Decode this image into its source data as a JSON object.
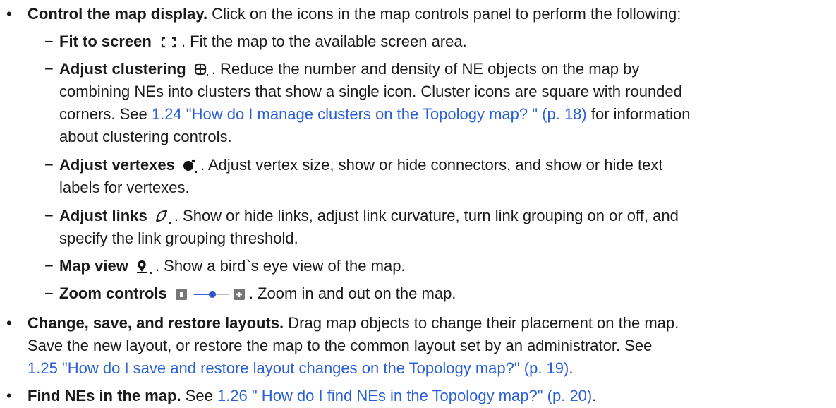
{
  "bullets": [
    {
      "title": "Control the map display.",
      "text": " Click on the icons in the map controls panel to perform the following:",
      "subitems": [
        {
          "title": "Fit to screen",
          "icon": "fit-screen-icon",
          "lines": [
            ". Fit the map to the available screen area."
          ]
        },
        {
          "title": "Adjust clustering",
          "icon": "cluster-icon",
          "lines": [
            ". Reduce the number and density of NE objects on the map by",
            "combining NEs into clusters that show a single icon. Cluster icons are square with rounded",
            "corners. See "
          ],
          "link": "1.24  \"How do I manage clusters on the Topology map? \" (p. 18)",
          "after_link": " for information",
          "last_line": "about clustering controls."
        },
        {
          "title": "Adjust vertexes",
          "icon": "vertex-icon",
          "lines": [
            ". Adjust vertex size, show or hide connectors, and show or hide text",
            "labels for vertexes."
          ]
        },
        {
          "title": "Adjust links",
          "icon": "links-icon",
          "lines": [
            ". Show or hide links, adjust link curvature, turn link grouping on or off, and",
            "specify the link grouping threshold."
          ]
        },
        {
          "title": "Map view",
          "icon": "map-view-icon",
          "lines": [
            ". Show a bird`s eye view of the map."
          ]
        },
        {
          "title": "Zoom controls",
          "icon": "zoom-controls-icon",
          "lines": [
            ". Zoom in and out on the map."
          ]
        }
      ]
    },
    {
      "title": "Change, save, and restore layouts.",
      "lines": [
        " Drag map objects to change their placement on the map.",
        "Save the new layout, or restore the map to the common layout set by an administrator. See"
      ],
      "link": "1.25  \"How do I save and restore layout changes on the Topology map?\" (p. 19)",
      "after_link": "."
    },
    {
      "title": "Find NEs in the map.",
      "text": " See ",
      "link": "1.26  \" How do I find NEs in the Topology map?\" (p. 20)",
      "after_link": "."
    }
  ],
  "colors": {
    "link": "#2a5fd6",
    "text": "#1a1a1a"
  }
}
